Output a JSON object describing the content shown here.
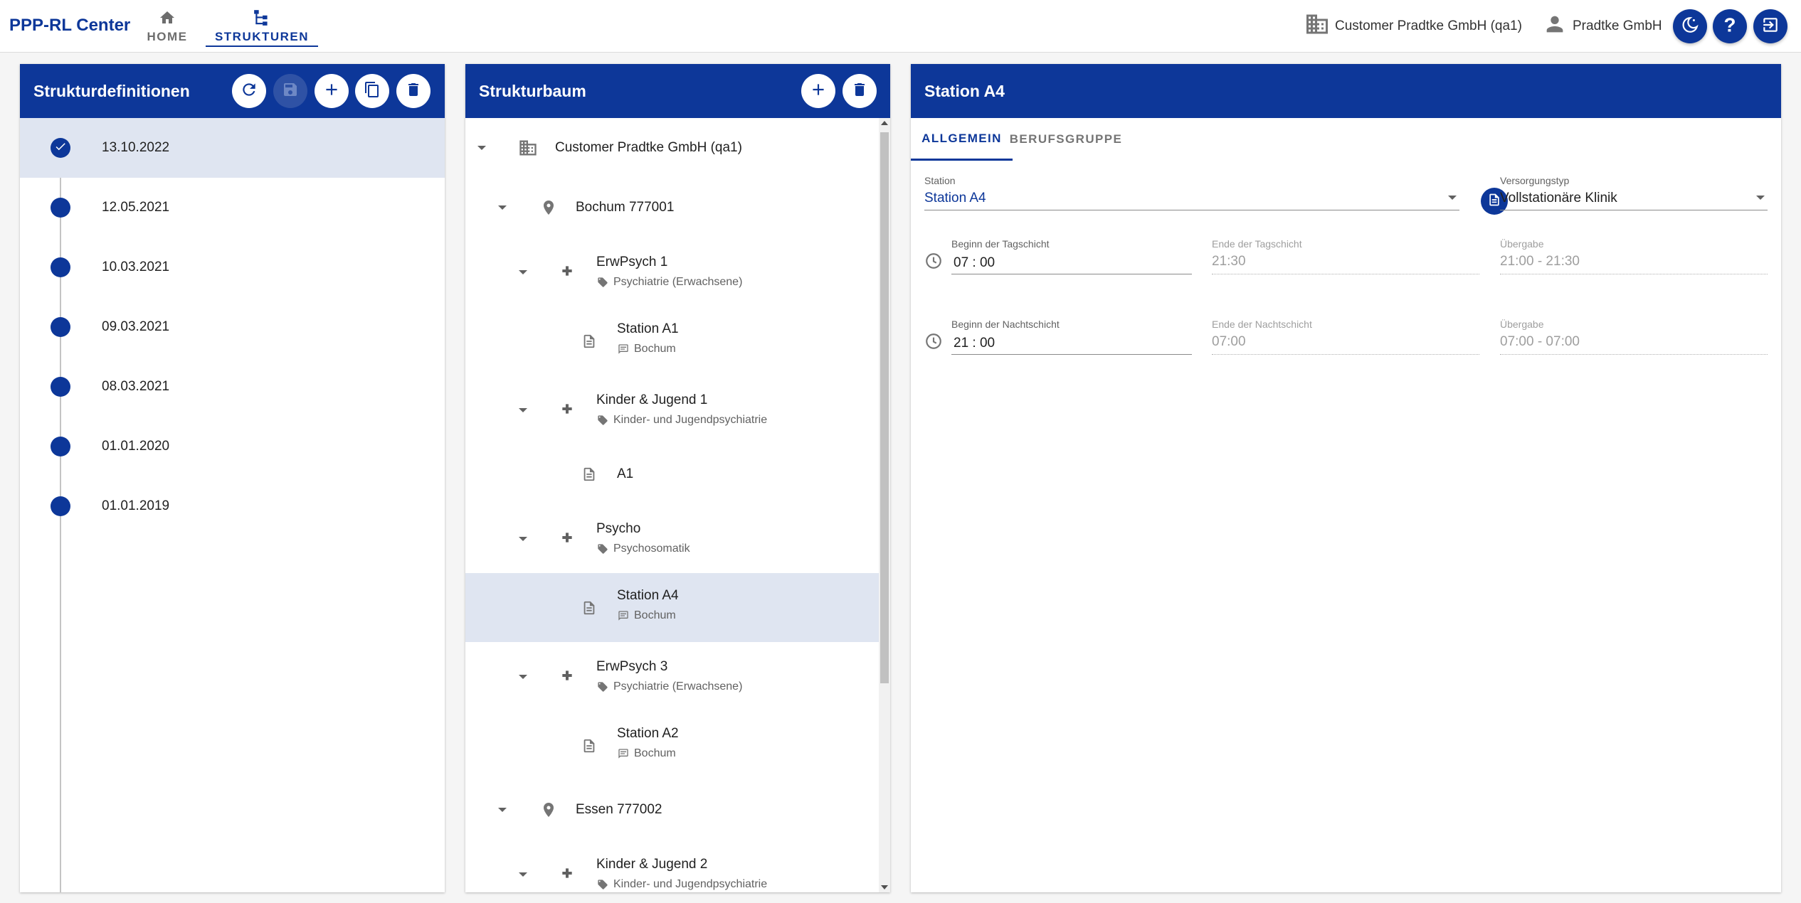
{
  "app": {
    "title": "PPP-RL Center"
  },
  "nav": {
    "home": "HOME",
    "structures": "STRUKTUREN"
  },
  "topbar": {
    "organization": "Customer Pradtke GmbH (qa1)",
    "user": "Pradtke GmbH"
  },
  "left_panel": {
    "title": "Strukturdefinitionen",
    "items": [
      {
        "date": "13.10.2022",
        "selected": true
      },
      {
        "date": "12.05.2021"
      },
      {
        "date": "10.03.2021"
      },
      {
        "date": "09.03.2021"
      },
      {
        "date": "08.03.2021"
      },
      {
        "date": "01.01.2020"
      },
      {
        "date": "01.01.2019"
      }
    ]
  },
  "tree_panel": {
    "title": "Strukturbaum",
    "nodes": [
      {
        "label": "Customer Pradtke GmbH (qa1)",
        "icon": "building-icon"
      },
      {
        "label": "Bochum 777001",
        "icon": "location-pin-icon"
      },
      {
        "label": "ErwPsych 1",
        "sub": "Psychiatrie (Erwachsene)",
        "icon": "medical-cross-icon"
      },
      {
        "label": "Station A1",
        "sub": "Bochum",
        "icon": "document-icon"
      },
      {
        "label": "Kinder & Jugend 1",
        "sub": "Kinder- und Jugendpsychiatrie",
        "icon": "medical-cross-icon"
      },
      {
        "label": "A1",
        "icon": "document-icon"
      },
      {
        "label": "Psycho",
        "sub": "Psychosomatik",
        "icon": "medical-cross-icon"
      },
      {
        "label": "Station A4",
        "sub": "Bochum",
        "icon": "document-icon",
        "selected": true
      },
      {
        "label": "ErwPsych 3",
        "sub": "Psychiatrie (Erwachsene)",
        "icon": "medical-cross-icon"
      },
      {
        "label": "Station A2",
        "sub": "Bochum",
        "icon": "document-icon"
      },
      {
        "label": "Essen 777002",
        "icon": "location-pin-icon"
      },
      {
        "label": "Kinder & Jugend 2",
        "sub": "Kinder- und Jugendpsychiatrie",
        "icon": "medical-cross-icon"
      }
    ]
  },
  "detail": {
    "title": "Station A4",
    "tabs": {
      "general": "ALLGEMEIN",
      "profession": "BERUFSGRUPPE"
    },
    "station": {
      "label": "Station",
      "value": "Station A4"
    },
    "care_type": {
      "label": "Versorgungstyp",
      "value": "Vollstationäre Klinik"
    },
    "day_shift": {
      "start_label": "Beginn der Tagschicht",
      "start_value": "07 : 00",
      "end_label": "Ende der Tagschicht",
      "end_value": "21:30",
      "handover_label": "Übergabe",
      "handover_value": "21:00 - 21:30"
    },
    "night_shift": {
      "start_label": "Beginn der Nachtschicht",
      "start_value": "21 : 00",
      "end_label": "Ende der Nachtschicht",
      "end_value": "07:00",
      "handover_label": "Übergabe",
      "handover_value": "07:00 - 07:00"
    }
  },
  "colors": {
    "primary": "#0d3799",
    "selected_row": "#dfe5f1"
  }
}
